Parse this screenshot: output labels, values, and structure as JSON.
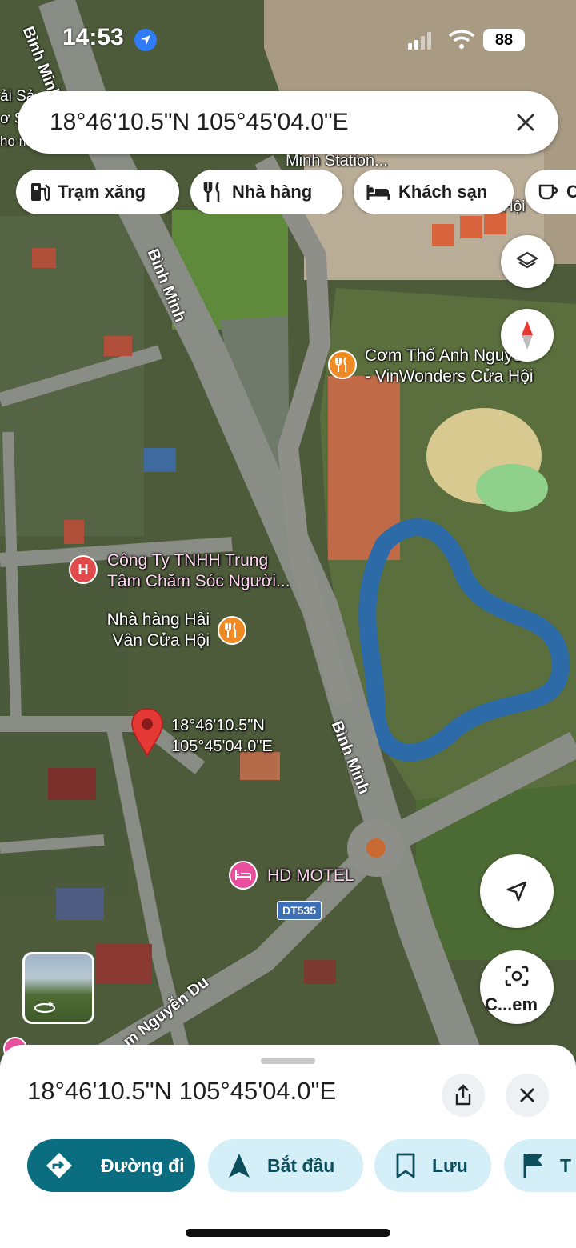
{
  "status_bar": {
    "time": "14:53",
    "battery": "88"
  },
  "search": {
    "value": "18°46'10.5\"N 105°45'04.0\"E"
  },
  "chips": [
    {
      "label": "Trạm xăng",
      "icon": "gas-station-icon"
    },
    {
      "label": "Nhà hàng",
      "icon": "restaurant-icon"
    },
    {
      "label": "Khách sạn",
      "icon": "hotel-icon"
    },
    {
      "label": "C",
      "icon": "coffee-icon"
    }
  ],
  "map": {
    "labels": {
      "road_top": "Bình Minh",
      "road_mid": "Bình Minh",
      "road_lower": "Bình Minh",
      "road_nguyen_du": "m Nguyễn Du",
      "station": "Minh Station...",
      "hoi_fragment": "Hội",
      "top_left_fragment_1": "ải Sả",
      "top_left_fragment_2": "ơ S",
      "top_left_fragment_3": "ho m",
      "poi_com_tho_line1": "Cơm Thố Anh Nguyễn",
      "poi_com_tho_line2": "- VinWonders Cửa Hội",
      "poi_company_line1": "Công Ty TNHH Trung",
      "poi_company_line2": "Tâm Chăm Sóc Người...",
      "poi_hai_van_line1": "Nhà hàng Hải",
      "poi_hai_van_line2": "Vân Cửa Hội",
      "pin_line1": "18°46'10.5\"N",
      "pin_line2": "105°45'04.0\"E",
      "motel": "HD MOTEL",
      "route_shield": "DT535"
    },
    "lens_label": "C...em"
  },
  "sheet": {
    "coords": "18°46'10.5\"N 105°45'04.0\"E",
    "actions": [
      {
        "label": "Đường đi",
        "icon": "directions-icon"
      },
      {
        "label": "Bắt đầu",
        "icon": "navigation-arrow-icon"
      },
      {
        "label": "Lưu",
        "icon": "bookmark-icon"
      },
      {
        "label": "T",
        "icon": "flag-icon"
      }
    ]
  },
  "colors": {
    "primary": "#0b6e80",
    "secondary": "#d4eff7",
    "pin": "#e53935",
    "restaurant": "#f08a24",
    "hotel": "#e84f9d"
  }
}
